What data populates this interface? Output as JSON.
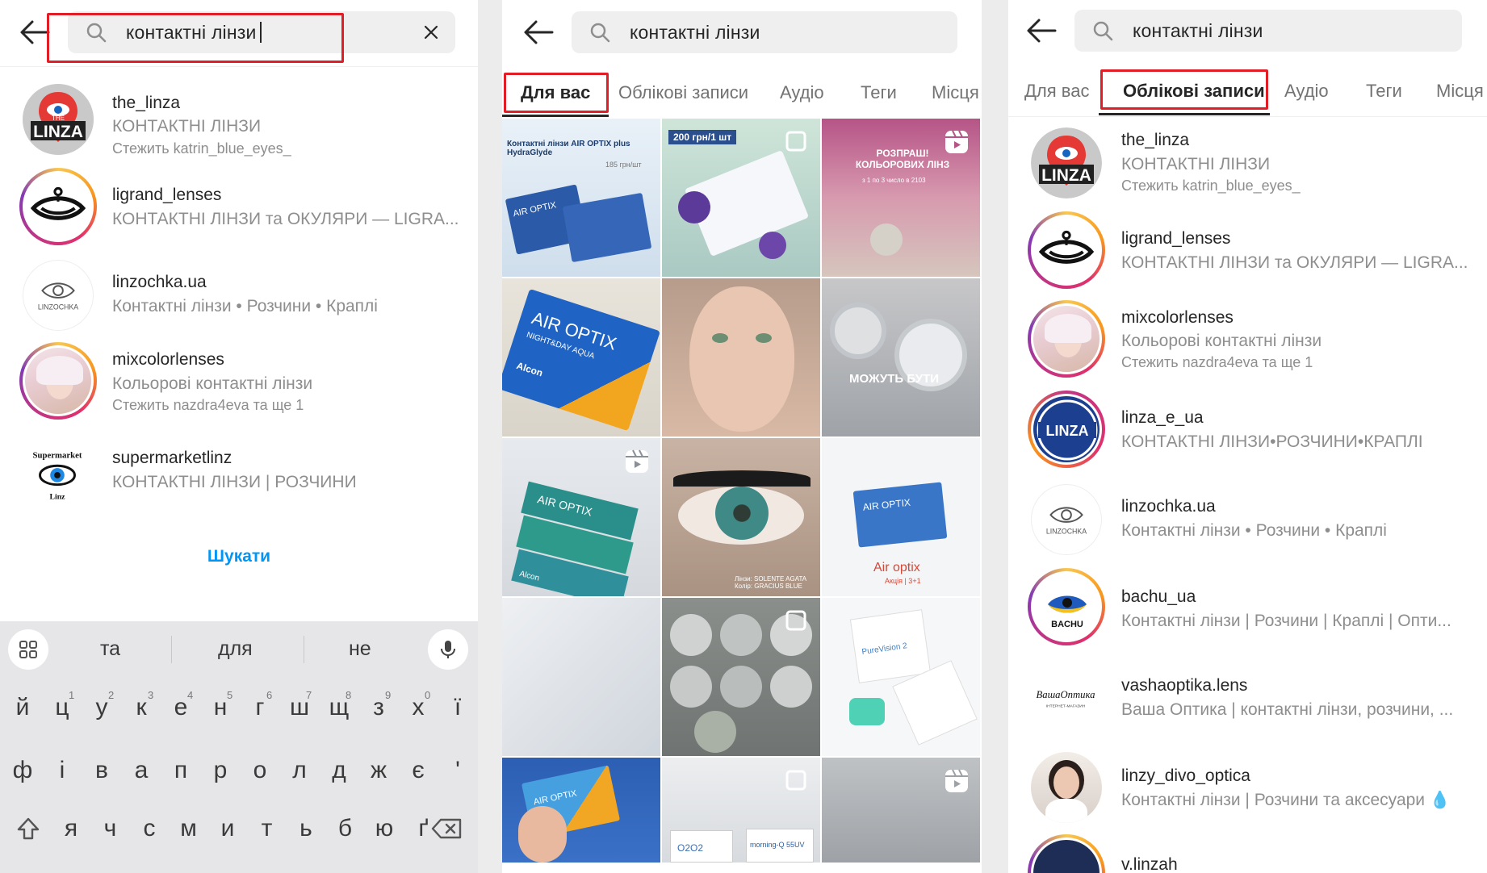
{
  "search": {
    "query": "контактні лінзи"
  },
  "panel1": {
    "accounts": [
      {
        "username": "the_linza",
        "desc": "КОНТАКТНІ ЛІНЗИ",
        "extra": "Стежить katrin_blue_eyes_"
      },
      {
        "username": "ligrand_lenses",
        "desc": "КОНТАКТНІ ЛІНЗИ та ОКУЛЯРИ — LIGRA..."
      },
      {
        "username": "linzochka.ua",
        "desc": "Контактні лінзи • Розчини • Краплі"
      },
      {
        "username": "mixcolorlenses",
        "desc": "Кольорові контактні лінзи",
        "extra": "Стежить nazdra4eva та ще 1"
      },
      {
        "username": "supermarketlinz",
        "desc": "КОНТАКТНІ ЛІНЗИ | РОЗЧИНИ"
      }
    ],
    "search_button": "Шукати",
    "keyboard": {
      "suggestions": [
        "та",
        "для",
        "не"
      ],
      "row1": [
        "й",
        "ц",
        "у",
        "к",
        "е",
        "н",
        "г",
        "ш",
        "щ",
        "з",
        "х",
        "ї"
      ],
      "row1_nums": [
        "1",
        "2",
        "3",
        "4",
        "5",
        "6",
        "7",
        "8",
        "9",
        "0"
      ],
      "row2": [
        "ф",
        "і",
        "в",
        "а",
        "п",
        "р",
        "о",
        "л",
        "д",
        "ж",
        "є",
        "'"
      ],
      "row3": [
        "я",
        "ч",
        "с",
        "м",
        "и",
        "т",
        "ь",
        "б",
        "ю",
        "ґ"
      ]
    }
  },
  "tabs": [
    "Для вас",
    "Облікові записи",
    "Аудіо",
    "Теги",
    "Місця"
  ],
  "panel2": {
    "active_tab": "Для вас",
    "grid_texts": {
      "c1_title": "Контактні лінзи AIR OPTIX plus HydraGlyde",
      "c1_price": "185 грн/шт",
      "c1_box": "AIR OPTIX",
      "c2_badge": "200 грн/1 шт",
      "c3_title": "РОЗПРАШ! КОЛЬОРОВИХ ЛІНЗ",
      "c3_sub": "з 1 по 3 число в 2103",
      "c4_box": "AIR OPTIX",
      "c4_sub": "NIGHT&DAY AQUA",
      "c4_brand": "Alcon",
      "c6_caption": "МОЖУТЬ БУТИ",
      "c7_box": "AIR OPTIX",
      "c7_brand": "Alcon",
      "c8_caption": "Лінзи: SOLENTE AGATA Колір: GRACIUS BLUE",
      "c9_box": "AIR OPTIX",
      "c9_title": "Air optix",
      "c9_sub": "Акція | 3+1",
      "c12_box": "PureVision 2",
      "c13_box": "AIR OPTIX",
      "c14_box": "O2O2",
      "c14_box2": "morning-Q 55UV"
    }
  },
  "panel3": {
    "active_tab": "Облікові записи",
    "accounts": [
      {
        "username": "the_linza",
        "desc": "КОНТАКТНІ ЛІНЗИ",
        "extra": "Стежить katrin_blue_eyes_"
      },
      {
        "username": "ligrand_lenses",
        "desc": "КОНТАКТНІ ЛІНЗИ та ОКУЛЯРИ — LIGRA..."
      },
      {
        "username": "mixcolorlenses",
        "desc": "Кольорові контактні лінзи",
        "extra": "Стежить nazdra4eva та ще 1"
      },
      {
        "username": "linza_e_ua",
        "desc": "КОНТАКТНІ ЛІНЗИ•РОЗЧИНИ•КРАПЛІ"
      },
      {
        "username": "linzochka.ua",
        "desc": "Контактні лінзи • Розчини • Краплі"
      },
      {
        "username": "bachu_ua",
        "desc": "Контактні лінзи | Розчини | Краплі | Опти..."
      },
      {
        "username": "vashaoptika.lens",
        "desc": "Ваша Оптика | контактні лінзи, розчини, ..."
      },
      {
        "username": "linzy_divo_optica",
        "desc": "Контактні лінзи | Розчини та аксесуари 💧"
      },
      {
        "username": "v.linzah"
      }
    ]
  },
  "logos": {
    "the_linza_top": "THE",
    "the_linza_word": "LINZA",
    "linzochka_word": "LINZOCHKA",
    "supermarket_word": "Supermarket",
    "supermarket_sub": "Linz",
    "linza_e_ua_word": "LINZA",
    "bachu_word": "BACHU",
    "vashaoptika_word": "ВашаОптика",
    "vashaoptika_sub": "ІНТЕРНЕТ-МАГАЗИН"
  },
  "colors": {
    "highlight": "#e11d25",
    "link": "#0095f6",
    "muted": "#8e8e8e",
    "text": "#262626"
  }
}
